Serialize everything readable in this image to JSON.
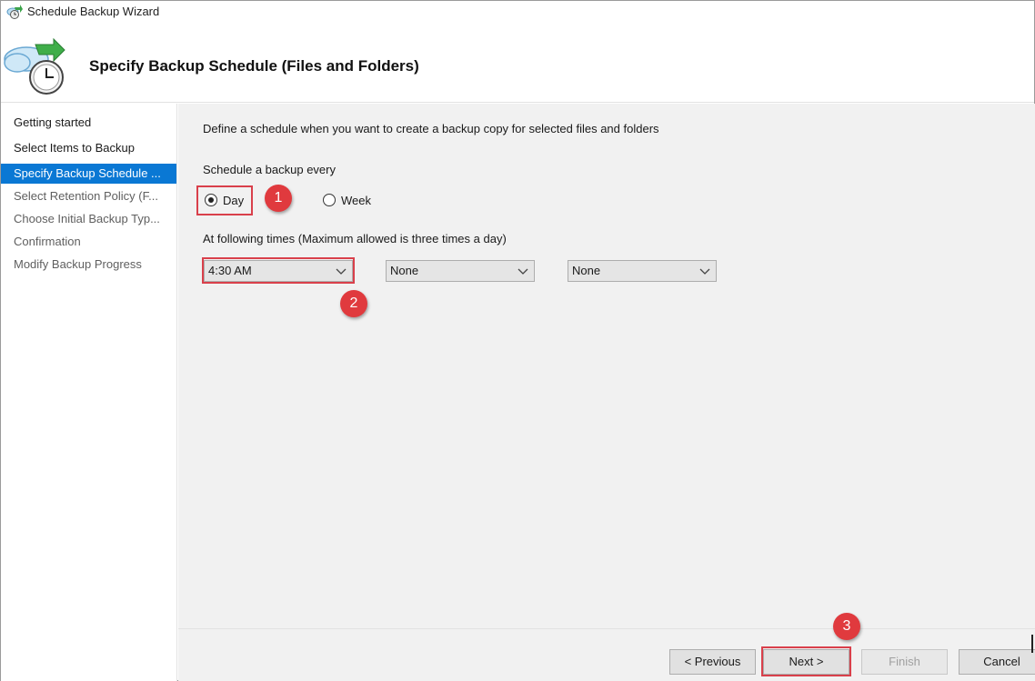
{
  "window": {
    "title": "Schedule Backup Wizard"
  },
  "header": {
    "title": "Specify Backup Schedule (Files and Folders)"
  },
  "nav": {
    "items": [
      {
        "label": "Getting started",
        "state": "done"
      },
      {
        "label": "Select Items to Backup",
        "state": "done"
      },
      {
        "label": "Specify Backup Schedule ...",
        "state": "active"
      },
      {
        "label": "Select Retention Policy (F...",
        "state": "pending"
      },
      {
        "label": "Choose Initial Backup Typ...",
        "state": "pending"
      },
      {
        "label": "Confirmation",
        "state": "pending"
      },
      {
        "label": "Modify Backup Progress",
        "state": "pending"
      }
    ]
  },
  "main": {
    "intro": "Define a schedule when you want to create a backup copy for selected files and folders",
    "schedule_label": "Schedule a backup every",
    "frequency": {
      "day_label": "Day",
      "week_label": "Week",
      "selected": "Day"
    },
    "times_label": "At following times (Maximum allowed is three times a day)",
    "times": [
      {
        "value": "4:30 AM"
      },
      {
        "value": "None"
      },
      {
        "value": "None"
      }
    ]
  },
  "callouts": [
    "1",
    "2",
    "3"
  ],
  "footer": {
    "previous_label": "< Previous",
    "next_label": "Next >",
    "finish_label": "Finish",
    "cancel_label": "Cancel"
  },
  "colors": {
    "accent": "#0a78d4",
    "highlight_box": "#d9404b",
    "callout": "#e03a3e",
    "panel_bg": "#f1f1f1"
  }
}
